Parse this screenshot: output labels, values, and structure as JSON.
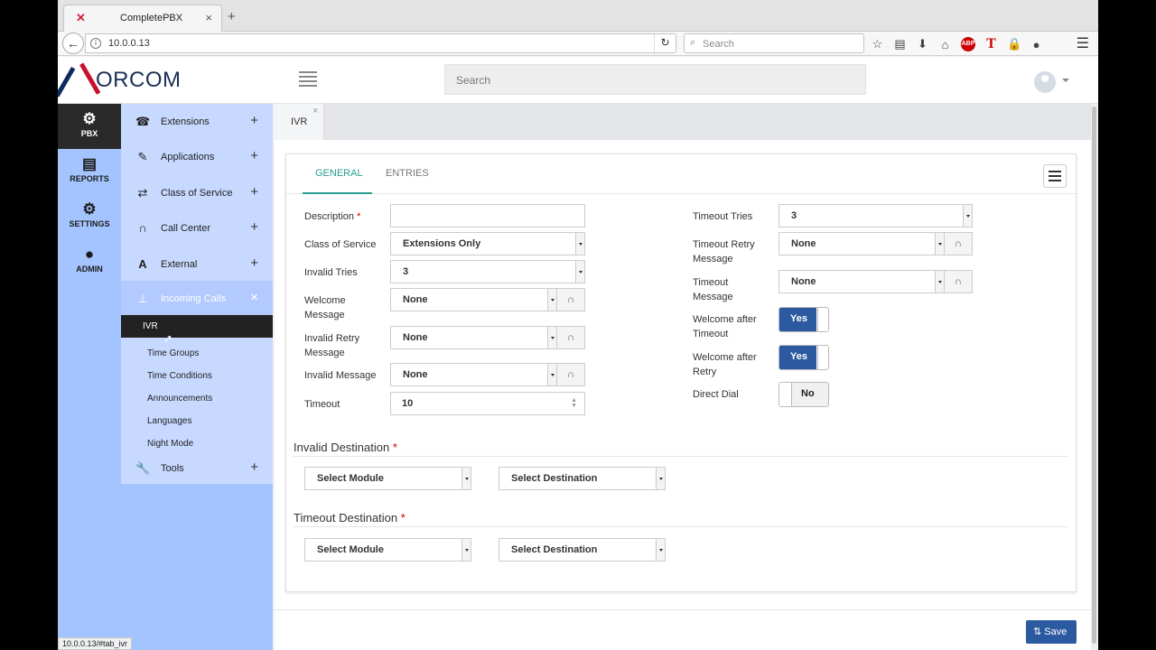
{
  "browser": {
    "tab_title": "CompletePBX",
    "url": "10.0.0.13",
    "search_placeholder": "Search",
    "status_url": "10.0.0.13/#tab_ivr"
  },
  "app": {
    "logo_text": "ORCOM",
    "search_placeholder": "Search"
  },
  "rail": [
    {
      "label": "PBX",
      "icon": "gear-icon",
      "active": true
    },
    {
      "label": "REPORTS",
      "icon": "document-icon",
      "active": false
    },
    {
      "label": "SETTINGS",
      "icon": "gears-icon",
      "active": false
    },
    {
      "label": "ADMIN",
      "icon": "users-icon",
      "active": false
    }
  ],
  "menu": {
    "items": [
      {
        "label": "Extensions",
        "icon": "phone-icon",
        "action": "+"
      },
      {
        "label": "Applications",
        "icon": "edit-icon",
        "action": "+"
      },
      {
        "label": "Class of Service",
        "icon": "shuffle-icon",
        "action": "+"
      },
      {
        "label": "Call Center",
        "icon": "headset-icon",
        "action": "+"
      },
      {
        "label": "External",
        "icon": "road-icon",
        "action": "+"
      },
      {
        "label": "Incoming Calls",
        "icon": "sitemap-icon",
        "action": "×"
      },
      {
        "label": "Tools",
        "icon": "wrench-icon",
        "action": "+"
      }
    ],
    "subitems": [
      "IVR",
      "Time Groups",
      "Time Conditions",
      "Announcements",
      "Languages",
      "Night Mode"
    ]
  },
  "content_tab": {
    "label": "IVR",
    "close": "×"
  },
  "panel": {
    "tabs": [
      "GENERAL",
      "ENTRIES"
    ],
    "left_fields": {
      "description_label": "Description",
      "class_of_service_label": "Class of Service",
      "class_of_service_value": "Extensions Only",
      "invalid_tries_label": "Invalid Tries",
      "invalid_tries_value": "3",
      "welcome_message_label": "Welcome Message",
      "welcome_message_value": "None",
      "invalid_retry_message_label": "Invalid Retry Message",
      "invalid_retry_message_value": "None",
      "invalid_message_label": "Invalid Message",
      "invalid_message_value": "None",
      "timeout_label": "Timeout",
      "timeout_value": "10"
    },
    "right_fields": {
      "timeout_tries_label": "Timeout Tries",
      "timeout_tries_value": "3",
      "timeout_retry_message_label": "Timeout Retry Message",
      "timeout_retry_message_value": "None",
      "timeout_message_label": "Timeout Message",
      "timeout_message_value": "None",
      "welcome_after_timeout_label": "Welcome after Timeout",
      "welcome_after_timeout_value": "Yes",
      "welcome_after_retry_label": "Welcome after Retry",
      "welcome_after_retry_value": "Yes",
      "direct_dial_label": "Direct Dial",
      "direct_dial_value": "No"
    },
    "invalid_destination": {
      "heading": "Invalid Destination",
      "module": "Select Module",
      "destination": "Select Destination"
    },
    "timeout_destination": {
      "heading": "Timeout Destination",
      "module": "Select Module",
      "destination": "Select Destination"
    },
    "required_mark": "*"
  },
  "footer": {
    "save_label": "Save"
  },
  "colors": {
    "accent": "#2a9d8f",
    "primary": "#2c5aa0",
    "sidebar": "#a4c4ff",
    "brand_red": "#c8102e"
  }
}
